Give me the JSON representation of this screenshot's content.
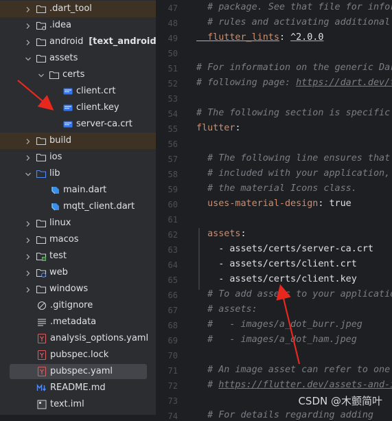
{
  "tree": [
    {
      "label": ".dart_tool",
      "chev": "right",
      "icon": "folder",
      "indent": 0,
      "excluded": true
    },
    {
      "label": ".idea",
      "chev": "right",
      "icon": "folder-config",
      "indent": 0
    },
    {
      "label": "android",
      "extra": "[text_android]",
      "chev": "right",
      "icon": "folder",
      "indent": 0
    },
    {
      "label": "assets",
      "chev": "down",
      "icon": "folder",
      "indent": 0
    },
    {
      "label": "certs",
      "chev": "down",
      "icon": "folder",
      "indent": 1
    },
    {
      "label": "client.crt",
      "icon": "cert",
      "indent": 2
    },
    {
      "label": "client.key",
      "icon": "cert",
      "indent": 2
    },
    {
      "label": "server-ca.crt",
      "icon": "cert",
      "indent": 2
    },
    {
      "label": "build",
      "chev": "right",
      "icon": "folder",
      "indent": 0,
      "excluded": true
    },
    {
      "label": "ios",
      "chev": "right",
      "icon": "folder",
      "indent": 0
    },
    {
      "label": "lib",
      "chev": "down",
      "icon": "folder-source",
      "indent": 0
    },
    {
      "label": "main.dart",
      "icon": "dart",
      "indent": 1
    },
    {
      "label": "mqtt_client.dart",
      "icon": "dart",
      "indent": 1
    },
    {
      "label": "linux",
      "chev": "right",
      "icon": "folder",
      "indent": 0
    },
    {
      "label": "macos",
      "chev": "right",
      "icon": "folder",
      "indent": 0
    },
    {
      "label": "test",
      "chev": "right",
      "icon": "folder-test",
      "indent": 0
    },
    {
      "label": "web",
      "chev": "right",
      "icon": "folder-web",
      "indent": 0
    },
    {
      "label": "windows",
      "chev": "right",
      "icon": "folder",
      "indent": 0
    },
    {
      "label": ".gitignore",
      "icon": "gitignore",
      "indent": 0
    },
    {
      "label": ".metadata",
      "icon": "text-lines",
      "indent": 0
    },
    {
      "label": "analysis_options.yaml",
      "icon": "yaml",
      "indent": 0
    },
    {
      "label": "pubspec.lock",
      "icon": "yaml",
      "indent": 0
    },
    {
      "label": "pubspec.yaml",
      "icon": "yaml",
      "indent": 0,
      "selected": true
    },
    {
      "label": "README.md",
      "icon": "markdown",
      "indent": 0
    },
    {
      "label": "text.iml",
      "icon": "iml",
      "indent": 0
    }
  ],
  "lines": [
    {
      "n": "47",
      "parts": [
        [
          "c-com",
          "  # package. See that file for infor"
        ]
      ]
    },
    {
      "n": "48",
      "parts": [
        [
          "c-com",
          "  # rules and activating additional"
        ]
      ]
    },
    {
      "n": "49",
      "parts": [
        [
          "c-key c-ul",
          "  flutter_lints"
        ],
        [
          "c-str",
          ": "
        ],
        [
          "c-num c-ul",
          "^2.0.0"
        ]
      ]
    },
    {
      "n": "50",
      "parts": []
    },
    {
      "n": "51",
      "parts": [
        [
          "c-com",
          "# For information on the generic Dar"
        ]
      ]
    },
    {
      "n": "52",
      "parts": [
        [
          "c-com",
          "# following page: "
        ],
        [
          "c-com c-link",
          "https://dart.dev/t"
        ]
      ]
    },
    {
      "n": "53",
      "parts": []
    },
    {
      "n": "54",
      "parts": [
        [
          "c-com",
          "# The following section is specific"
        ]
      ]
    },
    {
      "n": "55",
      "parts": [
        [
          "c-key",
          "flutter"
        ],
        [
          "c-str",
          ":"
        ]
      ]
    },
    {
      "n": "56",
      "parts": []
    },
    {
      "n": "57",
      "parts": [
        [
          "c-com",
          "  # The following line ensures that"
        ]
      ]
    },
    {
      "n": "58",
      "parts": [
        [
          "c-com",
          "  # included with your application,"
        ]
      ]
    },
    {
      "n": "59",
      "parts": [
        [
          "c-com",
          "  # the material Icons class."
        ]
      ]
    },
    {
      "n": "60",
      "parts": [
        [
          "c-key",
          "  uses-material-design"
        ],
        [
          "c-str",
          ": true"
        ]
      ]
    },
    {
      "n": "61",
      "parts": []
    },
    {
      "n": "62",
      "parts": [
        [
          "c-key",
          "  assets"
        ],
        [
          "c-str",
          ":"
        ]
      ]
    },
    {
      "n": "63",
      "parts": [
        [
          "c-str",
          "    - assets/certs/server-ca.crt"
        ]
      ]
    },
    {
      "n": "64",
      "parts": [
        [
          "c-str",
          "    - assets/certs/client.crt"
        ]
      ]
    },
    {
      "n": "65",
      "parts": [
        [
          "c-str",
          "    - assets/certs/client.key"
        ]
      ]
    },
    {
      "n": "66",
      "parts": [
        [
          "c-com",
          "  # To add assets to your applicatio"
        ]
      ]
    },
    {
      "n": "67",
      "parts": [
        [
          "c-com",
          "  # assets:"
        ]
      ]
    },
    {
      "n": "68",
      "parts": [
        [
          "c-com",
          "  #   - images/a_dot_burr.jpeg"
        ]
      ]
    },
    {
      "n": "69",
      "parts": [
        [
          "c-com",
          "  #   - images/a_dot_ham.jpeg"
        ]
      ]
    },
    {
      "n": "70",
      "parts": []
    },
    {
      "n": "71",
      "parts": [
        [
          "c-com",
          "  # An image asset can refer to one"
        ]
      ]
    },
    {
      "n": "72",
      "parts": [
        [
          "c-com",
          "  # "
        ],
        [
          "c-com c-link",
          "https://flutter.dev/assets-and-i"
        ]
      ]
    },
    {
      "n": "73",
      "parts": []
    },
    {
      "n": "74",
      "parts": [
        [
          "c-com",
          "  # For details regarding adding"
        ]
      ]
    }
  ],
  "watermark": "CSDN @木颤简叶"
}
